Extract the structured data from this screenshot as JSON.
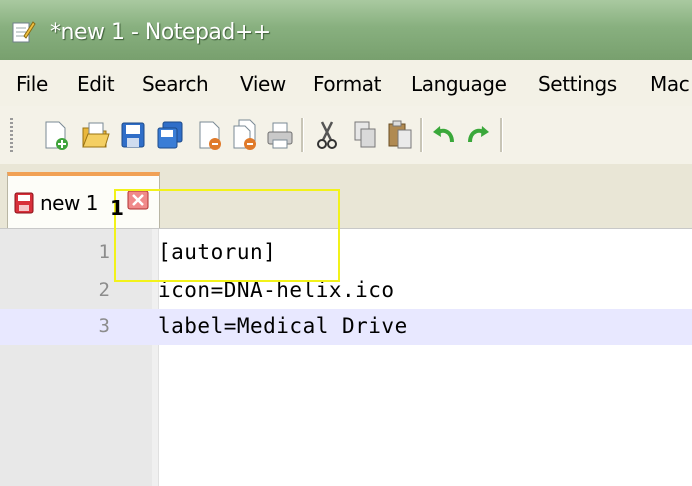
{
  "window": {
    "title": "*new 1 - Notepad++",
    "title_bar_color": "#88b07f"
  },
  "menu": {
    "items": [
      "File",
      "Edit",
      "Search",
      "View",
      "Format",
      "Language",
      "Settings",
      "Mac"
    ]
  },
  "toolbar": {
    "buttons": [
      "new-file-icon",
      "open-file-icon",
      "save-icon",
      "save-all-icon",
      "close-icon",
      "close-all-icon",
      "print-icon",
      "cut-icon",
      "copy-icon",
      "paste-icon",
      "undo-icon",
      "redo-icon"
    ]
  },
  "tabs": [
    {
      "label": "new 1",
      "modified": true,
      "accent_color": "#f1a155"
    }
  ],
  "editor": {
    "lines": [
      {
        "number": "1",
        "text": "[autorun]"
      },
      {
        "number": "2",
        "text": "icon=DNA-helix.ico"
      },
      {
        "number": "3",
        "text": "label=Medical Drive"
      }
    ],
    "current_line": 3,
    "current_line_color": "#e8e8ff"
  },
  "annotation": {
    "label": "1",
    "color": "#f2f21a"
  }
}
